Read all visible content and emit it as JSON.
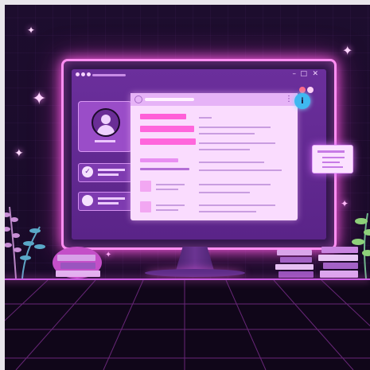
{
  "window": {
    "controls": {
      "minimize": "–",
      "maximize": "□",
      "close": "✕"
    }
  },
  "icons": {
    "sparkle": "✦",
    "check": "✓",
    "info": "i",
    "menu": "⋮"
  },
  "colors": {
    "accent": "#ff5fe6",
    "screen": "#6b2f9c",
    "panel": "#fadcfe",
    "pink_bar": "#ff5fd8",
    "info_badge": "#3fb8f0"
  }
}
